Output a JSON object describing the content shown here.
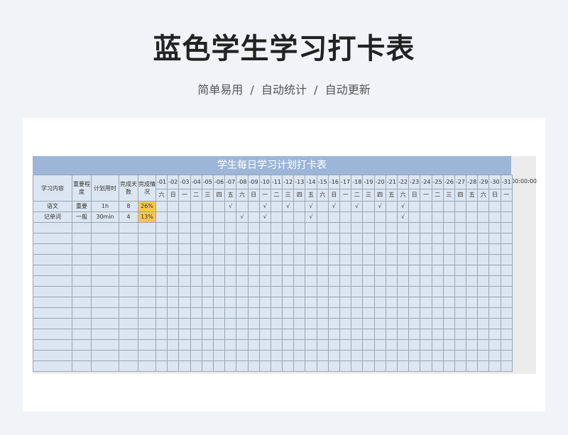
{
  "page": {
    "title": "蓝色学生学习打卡表",
    "subtitle_parts": [
      "简单易用",
      "自动统计",
      "自动更新"
    ],
    "separator": "/"
  },
  "sheet": {
    "title": "学生每日学习计划打卡表",
    "time": "00:00:00",
    "colors": {
      "header": "#9db6d8",
      "cell": "#dbe6f2",
      "highlight": "#f7c74f"
    },
    "headers": {
      "content": "学习内容",
      "importance": "重要程度",
      "plan": "计划用时",
      "done_days": "完成天数",
      "status": "完成情况"
    },
    "days": [
      "-01",
      "-02",
      "-03",
      "-04",
      "-05",
      "-06",
      "-07",
      "-08",
      "-09",
      "-10",
      "-11",
      "-12",
      "-13",
      "-14",
      "-15",
      "-16",
      "-17",
      "-18",
      "-19",
      "-20",
      "-21",
      "-22",
      "-23",
      "-24",
      "-25",
      "-26",
      "-27",
      "-28",
      "-29",
      "-30",
      "-31"
    ],
    "weekdays": [
      "六",
      "日",
      "一",
      "二",
      "三",
      "四",
      "五",
      "六",
      "日",
      "一",
      "二",
      "三",
      "四",
      "五",
      "六",
      "日",
      "一",
      "二",
      "三",
      "四",
      "五",
      "六",
      "日",
      "一",
      "二",
      "三",
      "四",
      "五",
      "六",
      "日",
      "一"
    ],
    "check_mark": "√",
    "rows": [
      {
        "content": "语文",
        "importance": "重要",
        "plan": "1h",
        "done_days": "8",
        "status": "26%",
        "checks": [
          7,
          10,
          12,
          14,
          16,
          18,
          20,
          22
        ]
      },
      {
        "content": "记单词",
        "importance": "一般",
        "plan": "30min",
        "done_days": "4",
        "status": "13%",
        "checks": [
          8,
          10,
          14,
          22
        ]
      }
    ],
    "empty_rows": 14
  }
}
